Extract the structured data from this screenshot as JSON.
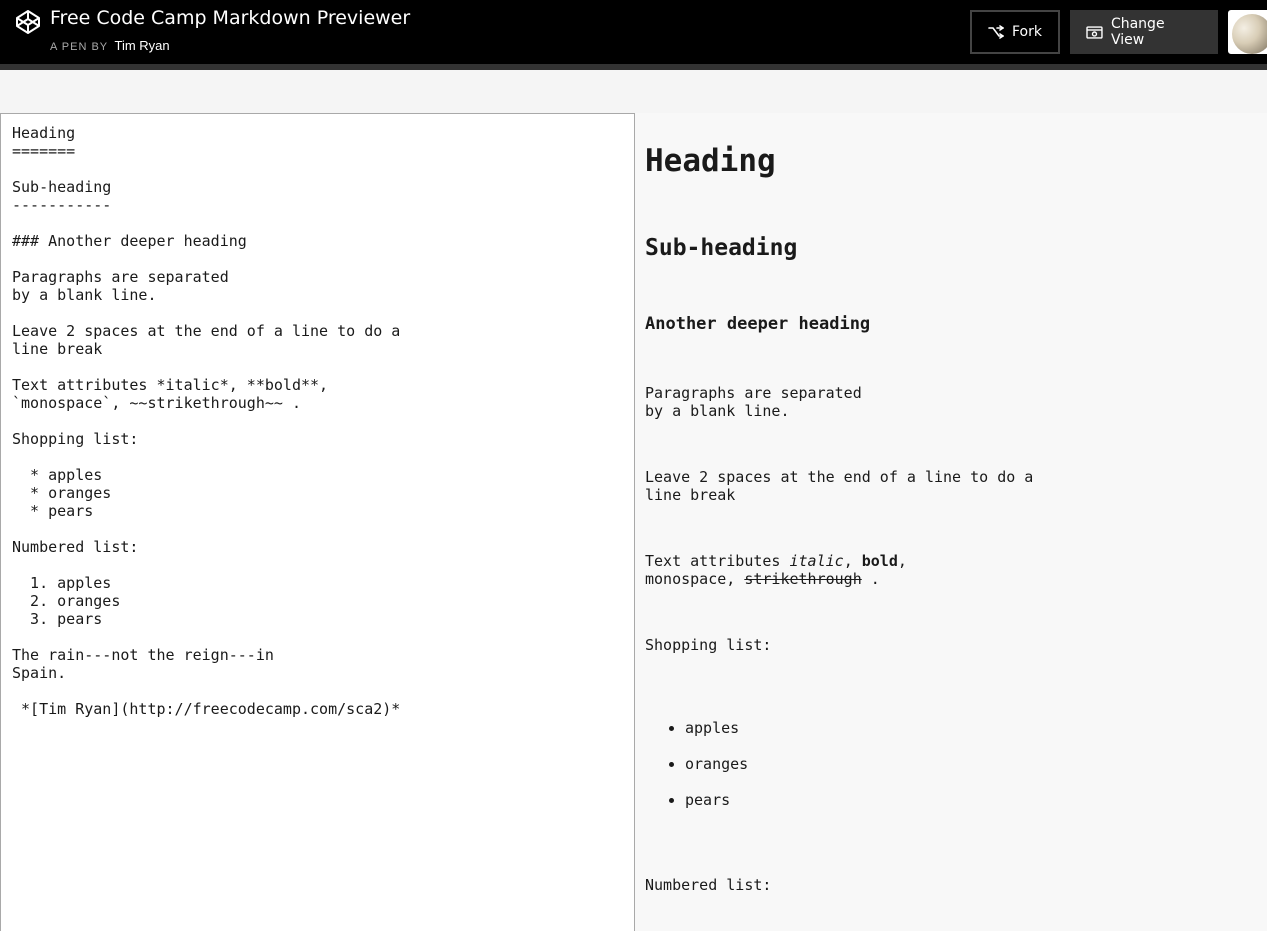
{
  "header": {
    "title": "Free Code Camp Markdown Previewer",
    "by_label": "A PEN BY",
    "author": "Tim Ryan",
    "fork_label": "Fork",
    "change_view_label": "Change View"
  },
  "editor": {
    "source": "Heading\n=======\n\nSub-heading\n-----------\n\n### Another deeper heading\n\nParagraphs are separated\nby a blank line.\n\nLeave 2 spaces at the end of a line to do a\nline break\n\nText attributes *italic*, **bold**,\n`monospace`, ~~strikethrough~~ .\n\nShopping list:\n\n  * apples\n  * oranges\n  * pears\n\nNumbered list:\n\n  1. apples\n  2. oranges\n  3. pears\n\nThe rain---not the reign---in\nSpain.\n\n *[Tim Ryan](http://freecodecamp.com/sca2)*"
  },
  "preview": {
    "h1": "Heading",
    "h2": "Sub-heading",
    "h3": "Another deeper heading",
    "p1_line1": "Paragraphs are separated",
    "p1_line2": "by a blank line.",
    "p2_line1": "Leave 2 spaces at the end of a line to do a",
    "p2_line2": "line break",
    "p3_prefix": "Text attributes ",
    "p3_italic": "italic",
    "p3_sep1": ", ",
    "p3_bold": "bold",
    "p3_sep2": ",",
    "p3_mono": "monospace",
    "p3_sep3": ", ",
    "p3_strike": "strikethrough",
    "p3_end": " .",
    "shopping_label": "Shopping list:",
    "shopping_items": [
      "apples",
      "oranges",
      "pears"
    ],
    "numbered_label": "Numbered list:"
  },
  "icons": {
    "logo": "codepen-logo-icon",
    "fork": "fork-icon",
    "change_view": "change-view-icon"
  }
}
